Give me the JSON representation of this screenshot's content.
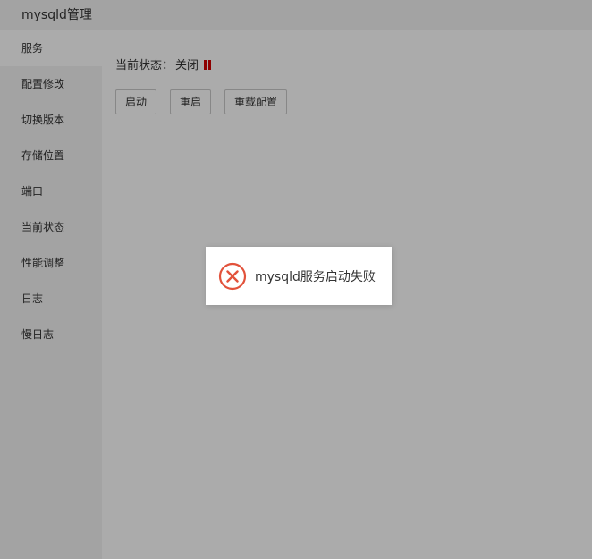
{
  "window": {
    "title": "mysqld管理"
  },
  "sidebar": {
    "items": [
      {
        "label": "服务",
        "active": true
      },
      {
        "label": "配置修改",
        "active": false
      },
      {
        "label": "切换版本",
        "active": false
      },
      {
        "label": "存储位置",
        "active": false
      },
      {
        "label": "端口",
        "active": false
      },
      {
        "label": "当前状态",
        "active": false
      },
      {
        "label": "性能调整",
        "active": false
      },
      {
        "label": "日志",
        "active": false
      },
      {
        "label": "慢日志",
        "active": false
      }
    ]
  },
  "main": {
    "status_label": "当前状态：",
    "status_value": "关闭",
    "status_icon": "stop-icon",
    "status_icon_color": "#d40000",
    "buttons": {
      "start": "启动",
      "restart": "重启",
      "reload_config": "重载配置"
    }
  },
  "toast": {
    "icon": "error-circle-icon",
    "icon_color": "#e2523b",
    "message": "mysqld服务启动失败"
  }
}
